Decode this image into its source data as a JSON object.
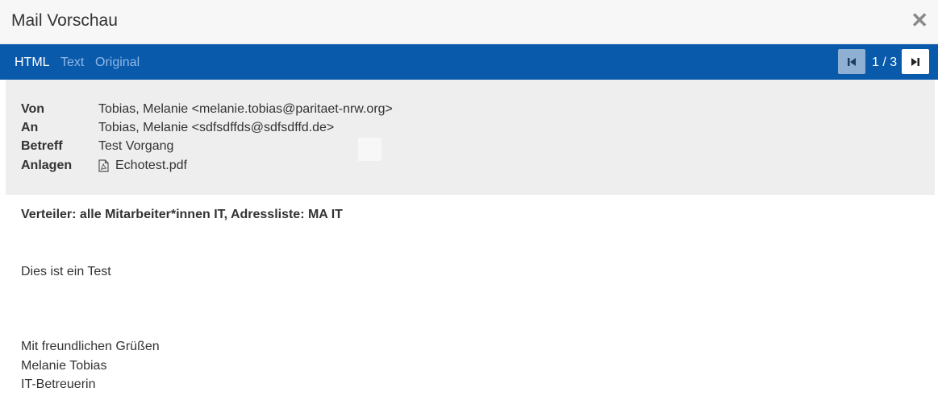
{
  "window": {
    "title": "Mail Vorschau",
    "close_icon": "close-icon"
  },
  "toolbar": {
    "tabs": [
      {
        "label": "HTML",
        "active": true
      },
      {
        "label": "Text",
        "active": false
      },
      {
        "label": "Original",
        "active": false
      }
    ],
    "pager": {
      "label": "1 / 3",
      "prev_icon": "skip-back-icon",
      "next_icon": "skip-forward-icon"
    },
    "accent_color": "#0a5aac"
  },
  "header": {
    "from_label": "Von",
    "from_value": "Tobias, Melanie <melanie.tobias@paritaet-nrw.org>",
    "to_label": "An",
    "to_value": "Tobias, Melanie <sdfsdffds@sdfsdffd.de>",
    "subject_label": "Betreff",
    "subject_value": "Test Vorgang",
    "attachments_label": "Anlagen",
    "attachment": {
      "name": "Echotest.pdf",
      "icon": "pdf-file-icon"
    }
  },
  "body": {
    "distribution": "Verteiler: alle Mitarbeiter*innen IT, Adressliste: MA IT",
    "text": "Dies ist ein Test",
    "greeting": "Mit freundlichen Grüßen",
    "signature_name": "Melanie Tobias",
    "signature_role": "IT-Betreuerin"
  }
}
